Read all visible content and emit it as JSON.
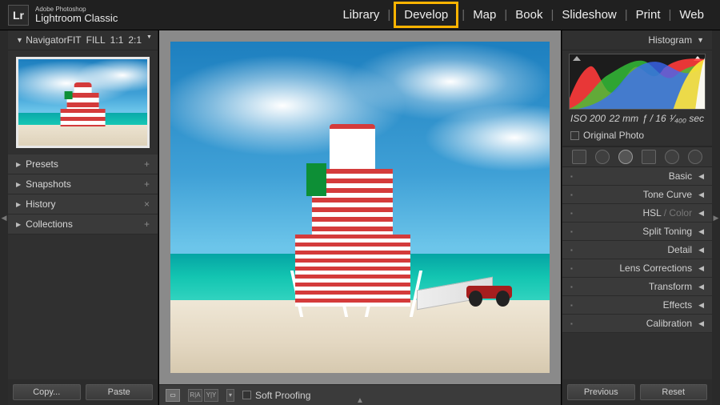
{
  "brand": {
    "logo": "Lr",
    "small": "Adobe Photoshop",
    "big": "Lightroom Classic"
  },
  "modules": {
    "items": [
      "Library",
      "Develop",
      "Map",
      "Book",
      "Slideshow",
      "Print",
      "Web"
    ],
    "active": "Develop"
  },
  "left": {
    "navigator": {
      "title": "Navigator",
      "zoom": [
        "FIT",
        "FILL",
        "1:1",
        "2:1"
      ],
      "zoom_active": "FIT"
    },
    "panels": [
      {
        "label": "Presets",
        "badge": "+"
      },
      {
        "label": "Snapshots",
        "badge": "+"
      },
      {
        "label": "History",
        "badge": "×"
      },
      {
        "label": "Collections",
        "badge": "+"
      }
    ],
    "buttons": {
      "copy": "Copy...",
      "paste": "Paste"
    }
  },
  "center": {
    "toolbar": {
      "soft_proofing": "Soft Proofing"
    }
  },
  "right": {
    "histogram": {
      "title": "Histogram",
      "iso": "ISO 200",
      "focal": "22 mm",
      "aperture": "ƒ / 16",
      "shutter": "¹⁄₄₀₀ sec",
      "original": "Original Photo"
    },
    "panels": [
      {
        "label": "Basic"
      },
      {
        "label": "Tone Curve"
      },
      {
        "label": "HSL",
        "dim": " / Color"
      },
      {
        "label": "Split Toning"
      },
      {
        "label": "Detail"
      },
      {
        "label": "Lens Corrections"
      },
      {
        "label": "Transform"
      },
      {
        "label": "Effects"
      },
      {
        "label": "Calibration"
      }
    ],
    "buttons": {
      "previous": "Previous",
      "reset": "Reset"
    }
  }
}
